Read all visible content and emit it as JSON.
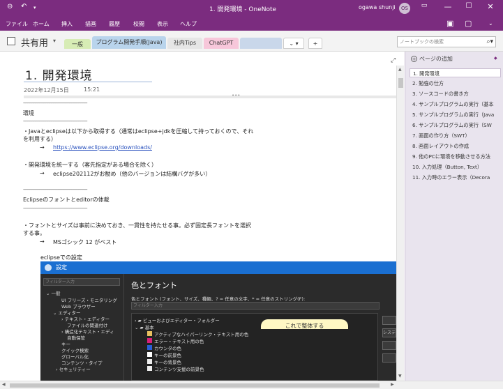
{
  "titlebar": {
    "title": "1. 開発環境 - OneNote",
    "user": "ogawa shunji",
    "avatar": "OS",
    "back_icon": "back-arrow-icon",
    "undo_icon": "undo-icon"
  },
  "ribbon": {
    "menus": [
      "ファイル",
      "ホーム",
      "挿入",
      "描画",
      "履歴",
      "校閲",
      "表示",
      "ヘルプ"
    ]
  },
  "notebook": {
    "name": "共有用",
    "tabs": [
      {
        "label": "一般",
        "color": "#d7ecb5"
      },
      {
        "label": "プログラム開発手順(Java)",
        "color": "#b9d4ec"
      },
      {
        "label": "社内Tips",
        "color": "#e6e6e6"
      },
      {
        "label": "ChatGPT",
        "color": "#f7c7da"
      },
      {
        "label": "",
        "color": "#c9d7ea"
      }
    ],
    "overflow": "⌄ ▾",
    "add_tab": "+"
  },
  "search": {
    "placeholder": "ノートブックの検索"
  },
  "page": {
    "title": "1. 開発環境",
    "date": "2022年12月15日",
    "time": "15:21",
    "lines": {
      "dash1": "------------------------------------------------------------",
      "env": "環境",
      "dash2": "------------------------------------------------------------",
      "jdk1": "・Javaとeclipseは以下から取得する（通常はeclipse+jdkを圧縮して持っておくので、それ",
      "jdk2": "を利用する）",
      "arrow1": "→",
      "url": "https://www.eclipse.org/downloads/",
      "unify": "・開発環境を統一する（客先指定がある場合を除く）",
      "arrow2": "→",
      "recommend": "eclipse202112がお勧め（他のバージョンは結構バグが多い）",
      "dash3": "------------------------------------------------------------",
      "font_title": "Eclipseのフォントとeditorの体裁",
      "dash4": "------------------------------------------------------------",
      "font1": "・フォントとサイズは事前に決めておき、一貫性を持たせる事。必ず固定長フォントを選択",
      "font2": "する事。",
      "arrow3": "→",
      "ms": "MSゴシック 12 がベスト",
      "eclipse_setting": "eclipseでの設定"
    }
  },
  "screenshot": {
    "window_title": "設定",
    "filter": "フィルター入力",
    "tree": [
      "一般",
      "UI フリーズ・モニタリング",
      "Web ブラウザー",
      "エディター",
      "テキスト・エディター",
      "ファイルの関連付け",
      "構造化テキスト・エディ",
      "自動保管",
      "キー",
      "クイック検索",
      "グローバル化",
      "コンテンツ・タイプ",
      "セキュリティー"
    ],
    "heading": "色とフォント",
    "desc": "色とフォント (フォント、サイズ、種類、? = 任意の文字、* = 任意のストリング(F):",
    "filter2": "フィルター入力",
    "items": [
      {
        "label": "ビューおよびエディター・フォルダー",
        "color": "#d8a840"
      },
      {
        "label": "基本",
        "color": "#d8a840"
      },
      {
        "label": "アクティブなハイパーリンク・テキスト用の色",
        "color": "#e8c060"
      },
      {
        "label": "エラー・テキスト用の色",
        "color": "#d8207a"
      },
      {
        "label": "カウンタの色",
        "color": "#2a60d8"
      },
      {
        "label": "キーの前景色",
        "color": "#ffffff"
      },
      {
        "label": "キーの背景色",
        "color": "#eeeeee"
      },
      {
        "label": "コンテンツ支援の前景色",
        "color": "#eeeeee"
      }
    ],
    "side_btn": "システ",
    "balloon": "これで整体する"
  },
  "pane": {
    "add_page": "ページの追加",
    "pages": [
      "1. 開発環境",
      "2. 勉強の仕方",
      "3. ソースコードの書き方",
      "4. サンプルプログラムの実行（基本",
      "5. サンプルプログラムの実行（Java",
      "6. サンプルプログラムの実行（SW",
      "7. 画面の作り方（SWT）",
      "8. 画面レイアウトの作成",
      "9. 他のPCに環境を移動させる方法",
      "10. 入力処理（Button, Text）",
      "11. 入力時のエラー表示（Decora"
    ]
  },
  "colors": {
    "brand": "#7b2c7f",
    "page_pane": "#e9e4ee",
    "link": "#2a52be"
  }
}
